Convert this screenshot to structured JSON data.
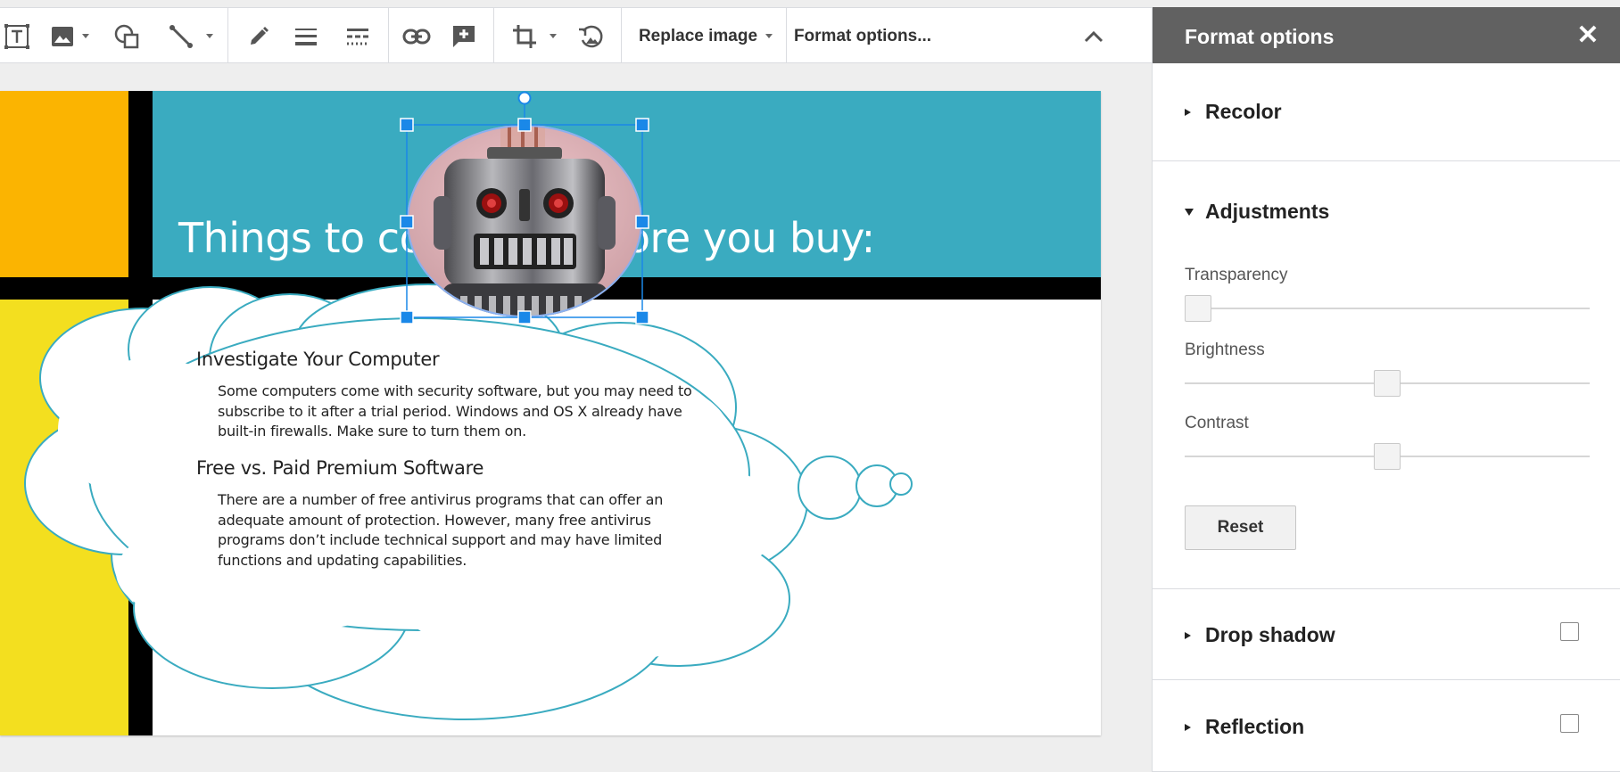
{
  "toolbar": {
    "replace_image_label": "Replace image",
    "format_options_label": "Format options..."
  },
  "slide": {
    "title": "Things to consider before you buy:",
    "colors": {
      "orange": "#fbb401",
      "yellow": "#f3df1f",
      "teal": "#3aabc0",
      "black": "#000000",
      "cloud_stroke": "#3aabc0",
      "selection": "#1a88e8"
    },
    "sections": [
      {
        "heading": "Investigate Your Computer",
        "lines": [
          "Some computers come with security software, but you may need to",
          "subscribe to it after a trial period. Windows and OS X already have",
          "built-in firewalls. Make sure to turn them on."
        ]
      },
      {
        "heading": "Free vs. Paid Premium Software",
        "lines": [
          "There are a number of free antivirus programs that can offer an",
          "adequate amount of protection. However, many free antivirus",
          "programs don’t include technical support and may have limited",
          "functions and updating capabilities."
        ]
      }
    ],
    "image_icon": "robot-image-icon"
  },
  "panel": {
    "title": "Format options",
    "close_glyph": "✕",
    "sections": {
      "recolor": "Recolor",
      "adjustments": "Adjustments",
      "drop_shadow": "Drop shadow",
      "reflection": "Reflection"
    },
    "adjustments": {
      "transparency_label": "Transparency",
      "brightness_label": "Brightness",
      "contrast_label": "Contrast",
      "transparency_value": 0,
      "brightness_value": 0.5,
      "contrast_value": 0.5,
      "reset_label": "Reset"
    },
    "drop_shadow_checked": false,
    "reflection_checked": false
  }
}
